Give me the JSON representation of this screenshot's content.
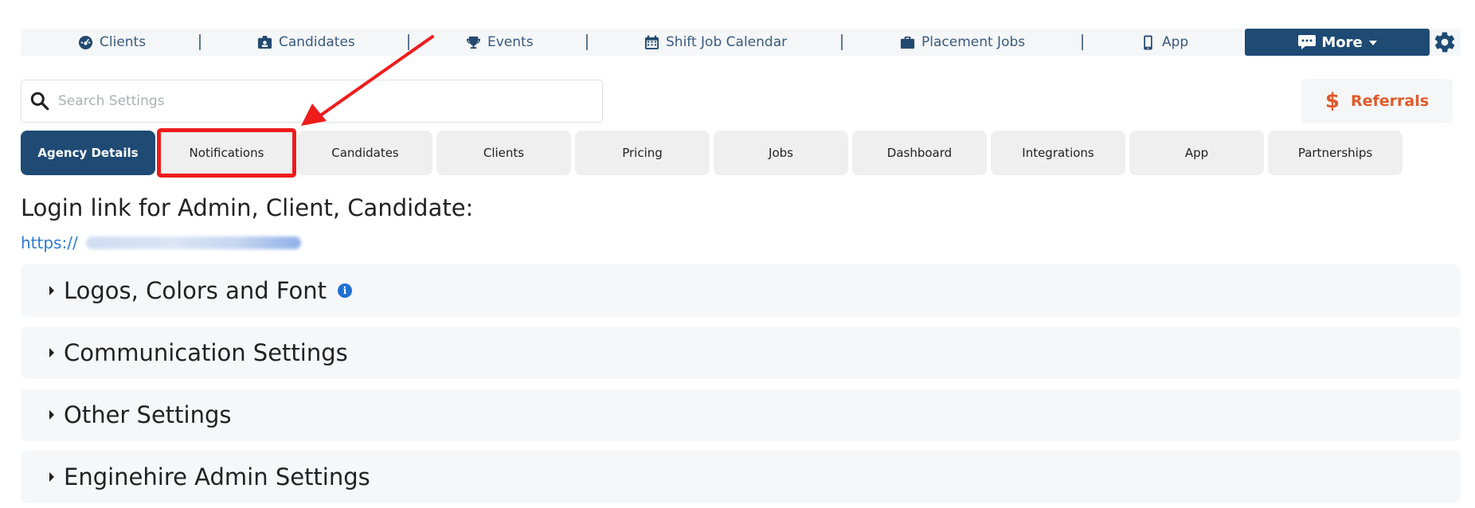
{
  "topnav": {
    "items": [
      {
        "label": "Clients",
        "icon": "dashboard-icon"
      },
      {
        "label": "Candidates",
        "icon": "id-badge-icon"
      },
      {
        "label": "Events",
        "icon": "trophy-icon"
      },
      {
        "label": "Shift Job Calendar",
        "icon": "calendar-icon"
      },
      {
        "label": "Placement Jobs",
        "icon": "briefcase-icon"
      },
      {
        "label": "App",
        "icon": "mobile-phone-icon"
      }
    ],
    "more_label": "More",
    "more_icon": "chat-icon",
    "settings_icon": "gear-icon"
  },
  "search": {
    "placeholder": "Search Settings",
    "value": ""
  },
  "referrals": {
    "label": "Referrals",
    "icon": "dollar-icon"
  },
  "tabs": [
    {
      "label": "Agency Details",
      "active": true
    },
    {
      "label": "Notifications",
      "highlighted": true
    },
    {
      "label": "Candidates"
    },
    {
      "label": "Clients"
    },
    {
      "label": "Pricing"
    },
    {
      "label": "Jobs"
    },
    {
      "label": "Dashboard"
    },
    {
      "label": "Integrations"
    },
    {
      "label": "App"
    },
    {
      "label": "Partnerships"
    }
  ],
  "login": {
    "title": "Login link for Admin, Client, Candidate:",
    "url_prefix": "https://"
  },
  "sections": [
    {
      "label": "Logos, Colors and Font",
      "info": true
    },
    {
      "label": "Communication Settings"
    },
    {
      "label": "Other Settings"
    },
    {
      "label": "Enginehire Admin Settings"
    }
  ],
  "colors": {
    "primary": "#1e4a74",
    "accent_orange": "#e05a2b",
    "link": "#2a7ad4",
    "annotation_red": "#ee1c1c"
  }
}
